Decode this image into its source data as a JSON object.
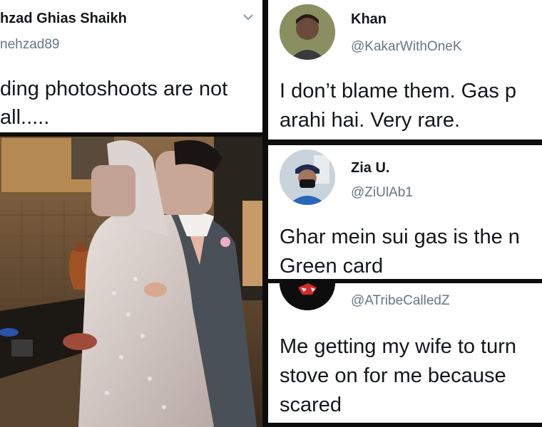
{
  "tweet1": {
    "name": "hzad Ghias Shaikh",
    "handle": "nehzad89",
    "body_line1": "ding photoshoots are not",
    "body_line2": "all.....",
    "menu_icon": "chevron-down-icon"
  },
  "tweet2": {
    "name": "Khan",
    "handle": "@KakarWithOneK",
    "body_line1": "I don’t blame them. Gas p",
    "body_line2": "arahi hai. Very rare."
  },
  "tweet3": {
    "name": "Zia U.",
    "handle": "@ZiUlAb1",
    "body_line1": "Ghar mein sui gas is the n",
    "body_line2": "Green card"
  },
  "tweet4": {
    "handle": "@ATribeCalledZ",
    "body_line1": "Me getting my wife to turn",
    "body_line2": "stove on for me because",
    "body_line3": "scared"
  },
  "colors": {
    "text": "#14171a",
    "secondary": "#657786",
    "separator": "#0d0d0d"
  }
}
